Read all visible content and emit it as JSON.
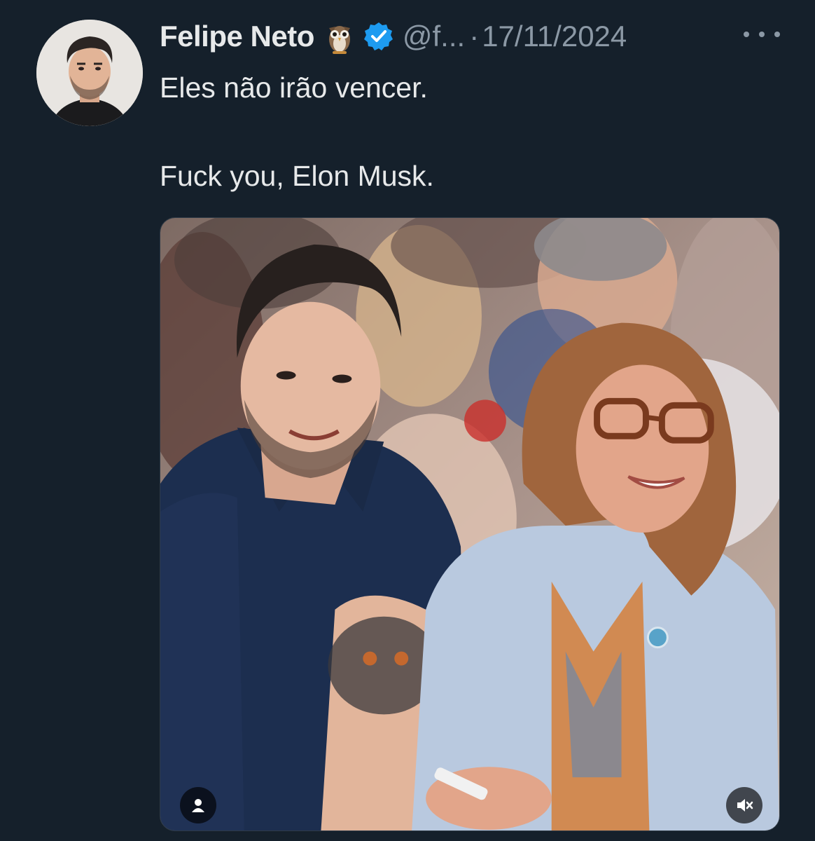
{
  "tweet": {
    "display_name": "Felipe Neto",
    "owl_emoji": "owl-icon",
    "verified_icon": "verified-badge-icon",
    "handle": "@f...",
    "separator": "·",
    "timestamp": "17/11/2024",
    "more_icon": "more-horizontal-icon",
    "text_line_1": "Eles não irão vencer.",
    "text_line_2": "Fuck you, Elon Musk.",
    "media": {
      "tag_icon": "person-tag-icon",
      "mute_icon": "speaker-muted-icon"
    }
  },
  "colors": {
    "background": "#15202b",
    "text": "#e7e9ea",
    "secondary_text": "#8b98a5",
    "verified_blue": "#1d9bf0"
  }
}
